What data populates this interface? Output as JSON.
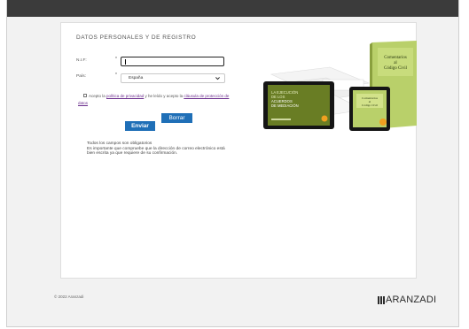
{
  "form": {
    "title": "DATOS PERSONALES Y DE REGISTRO",
    "nif": {
      "label": "N.I.F:",
      "required_mark": "*",
      "value": ""
    },
    "pais": {
      "label": "País:",
      "required_mark": "*",
      "selected": "España"
    },
    "consent": {
      "prefix": "Acepto la ",
      "privacy_link": "política de privacidad",
      "middle": " y he leído y acepto la ",
      "clause_link": "cláusula de protección de datos",
      "checked": false
    },
    "buttons": {
      "submit": "Enviar",
      "reset": "Borrar"
    },
    "notes": [
      "Todos los campos son obligatorios",
      "Es importante que compruebe que la dirección de correo electrónico está",
      "bien escrita ya que requiere de su confirmación."
    ]
  },
  "promo": {
    "tablet_left_lines": [
      "LA EJECUCIÓN",
      "DE LOS",
      "ACUERDOS",
      "DE MEDIACIÓN"
    ],
    "book_title_lines": [
      "Comentarios",
      "al",
      "Código Civil"
    ],
    "tablet_right_lines": [
      "Comentarios",
      "al",
      "Código Civil"
    ],
    "badge_color": "#f0a020",
    "accent_green": "#8dbb3a"
  },
  "footer": {
    "copyright": "© 2022 Aranzadi",
    "brand": "ARANZADI"
  },
  "colors": {
    "topbar": "#3b3b3b",
    "button": "#1f6fb7",
    "link": "#6a2c8c"
  }
}
